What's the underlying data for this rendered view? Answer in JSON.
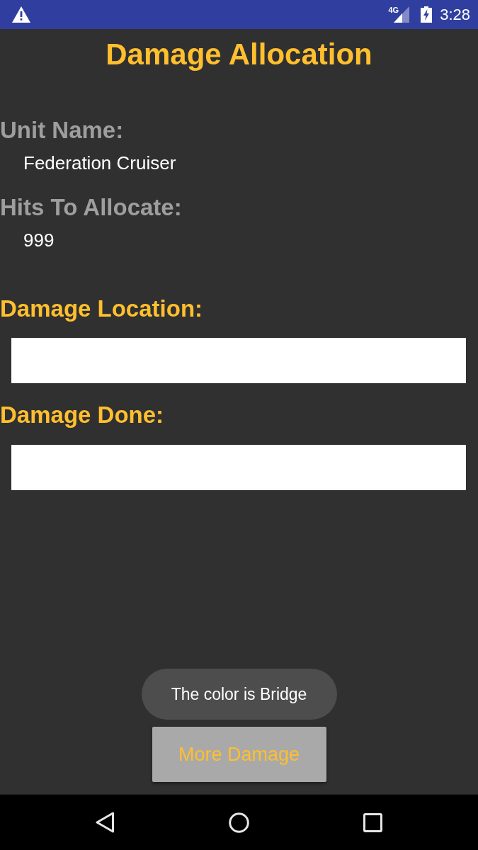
{
  "status_bar": {
    "network": "4G",
    "time": "3:28"
  },
  "title": "Damage Allocation",
  "info": [
    {
      "label": "Unit Name:",
      "value": "Federation Cruiser"
    },
    {
      "label": "Hits To Allocate:",
      "value": "999"
    }
  ],
  "inputs": [
    {
      "label": "Damage Location:"
    },
    {
      "label": "Damage Done:"
    }
  ],
  "toast": {
    "text": "The color is Bridge"
  },
  "button": {
    "label": "More Damage"
  }
}
